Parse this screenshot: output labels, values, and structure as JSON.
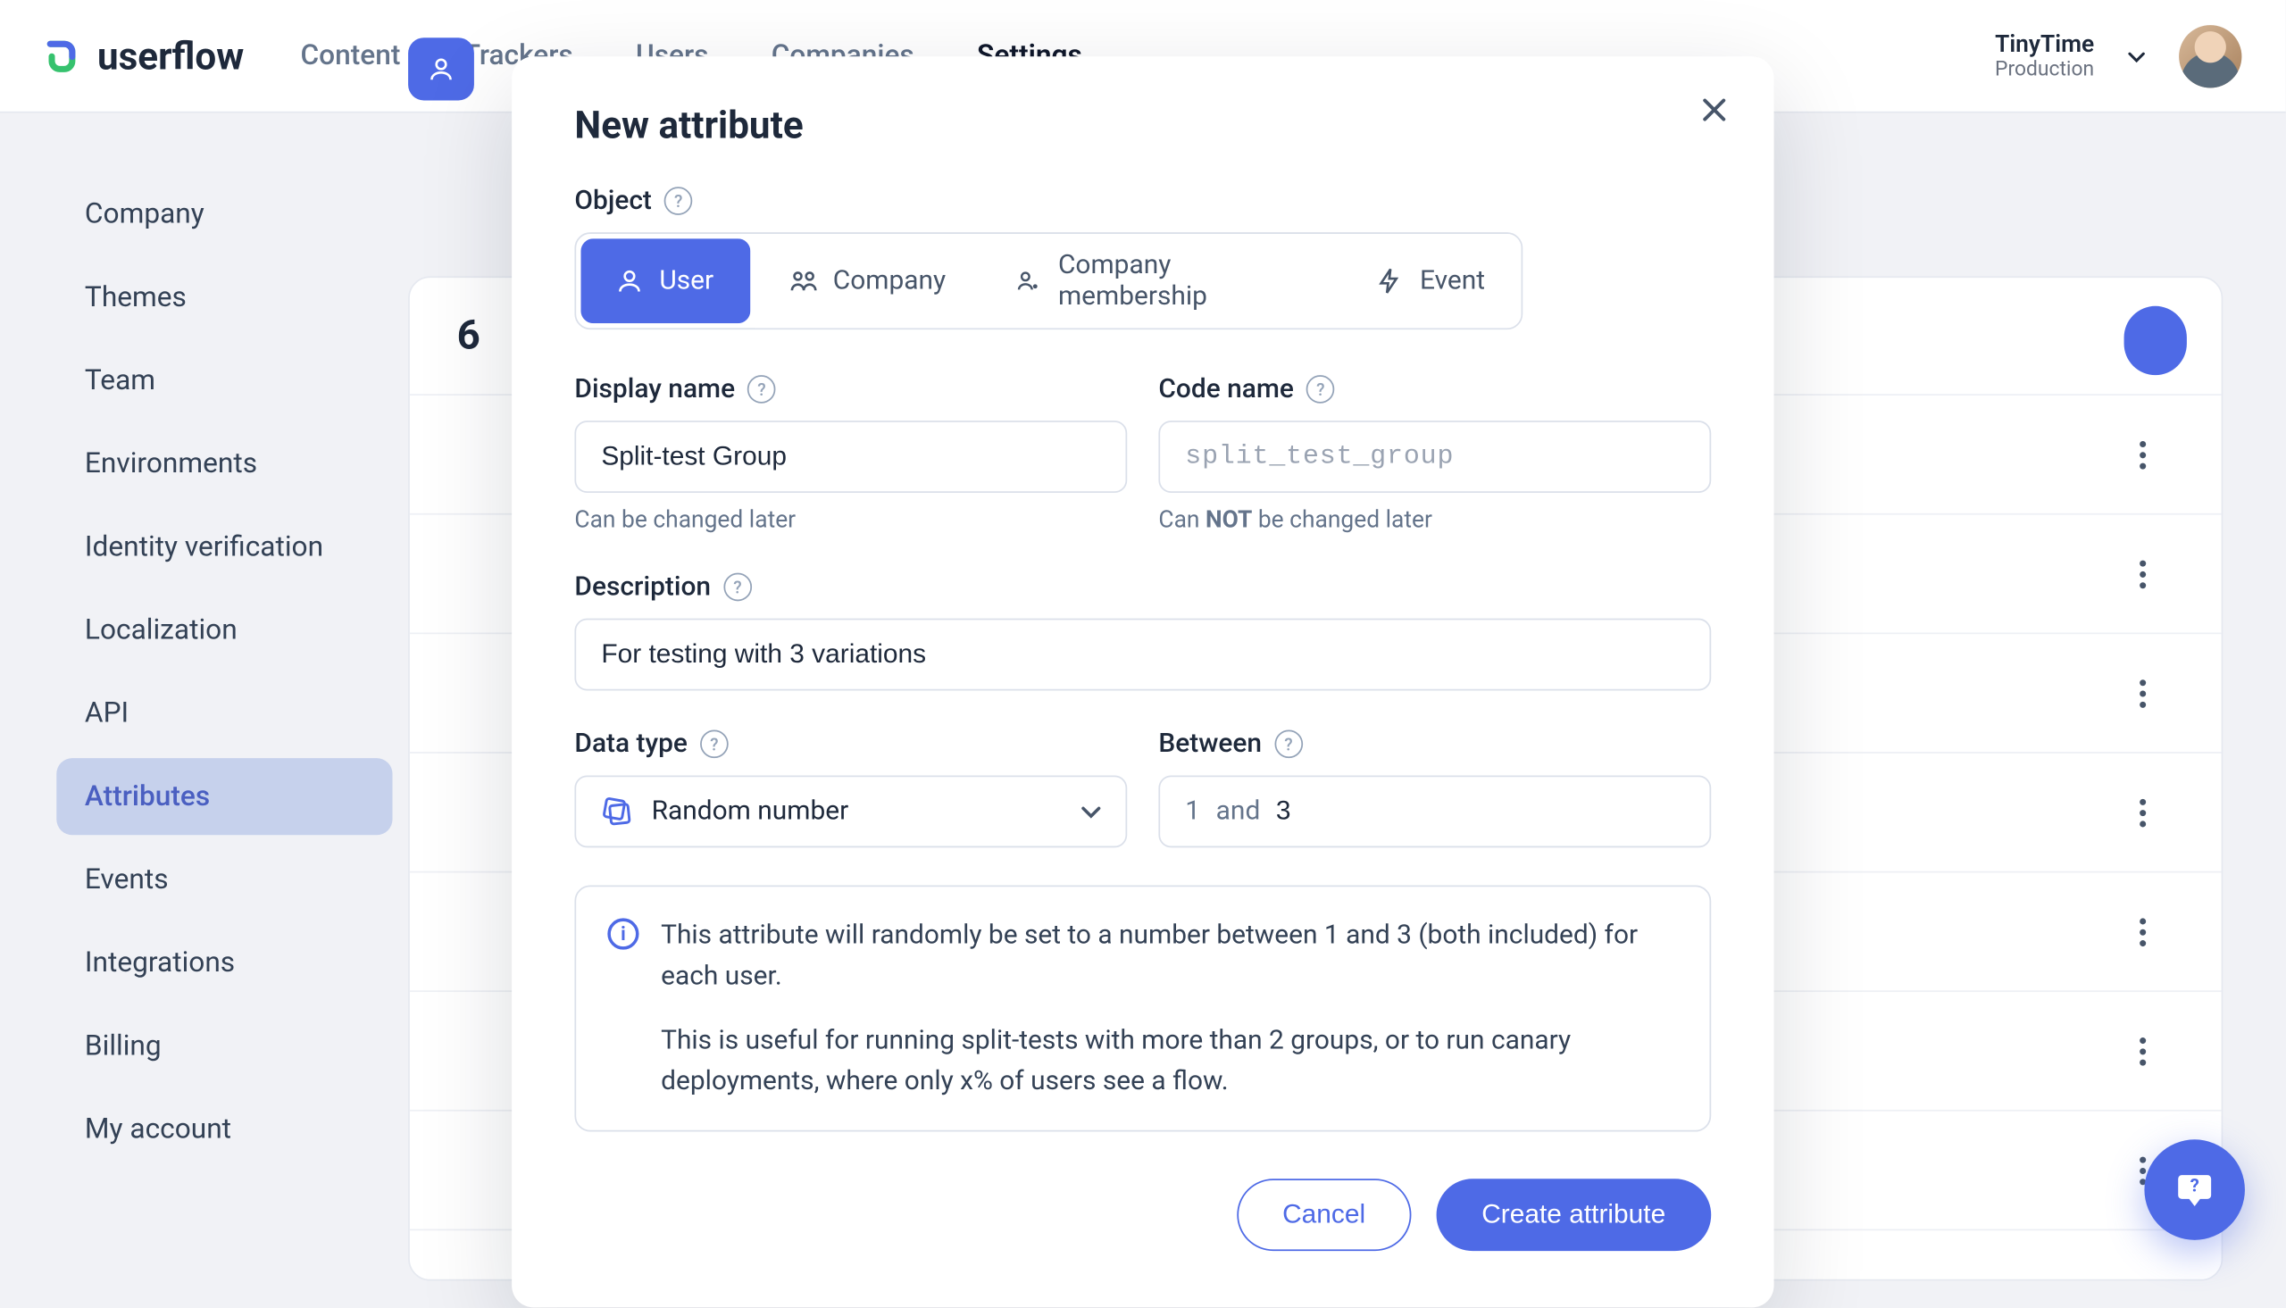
{
  "brand": "userflow",
  "nav": {
    "items": [
      "Content",
      "Trackers",
      "Users",
      "Companies",
      "Settings"
    ],
    "active": 4
  },
  "env": {
    "org": "TinyTime",
    "name": "Production"
  },
  "sidebar": {
    "items": [
      "Company",
      "Themes",
      "Team",
      "Environments",
      "Identity verification",
      "Localization",
      "API",
      "Attributes",
      "Events",
      "Integrations",
      "Billing",
      "My account"
    ],
    "active": 7
  },
  "bg": {
    "heading_prefix": "6",
    "row_count": 7
  },
  "modal": {
    "title": "New attribute",
    "object_label": "Object",
    "object_options": [
      "User",
      "Company",
      "Company membership",
      "Event"
    ],
    "object_active": 0,
    "display_name": {
      "label": "Display name",
      "value": "Split-test Group",
      "hint": "Can be changed later"
    },
    "code_name": {
      "label": "Code name",
      "placeholder": "split_test_group",
      "hint_pre": "Can ",
      "hint_b": "NOT",
      "hint_post": " be changed later"
    },
    "description": {
      "label": "Description",
      "value": "For testing with 3 variations"
    },
    "data_type": {
      "label": "Data type",
      "value": "Random number"
    },
    "between": {
      "label": "Between",
      "low": "1",
      "joiner": "and",
      "high": "3"
    },
    "info_p1": "This attribute will randomly be set to a number between 1 and 3 (both included) for each user.",
    "info_p2": "This is useful for running split-tests with more than 2 groups, or to run canary deployments, where only x% of users see a flow.",
    "cancel": "Cancel",
    "create": "Create attribute"
  }
}
